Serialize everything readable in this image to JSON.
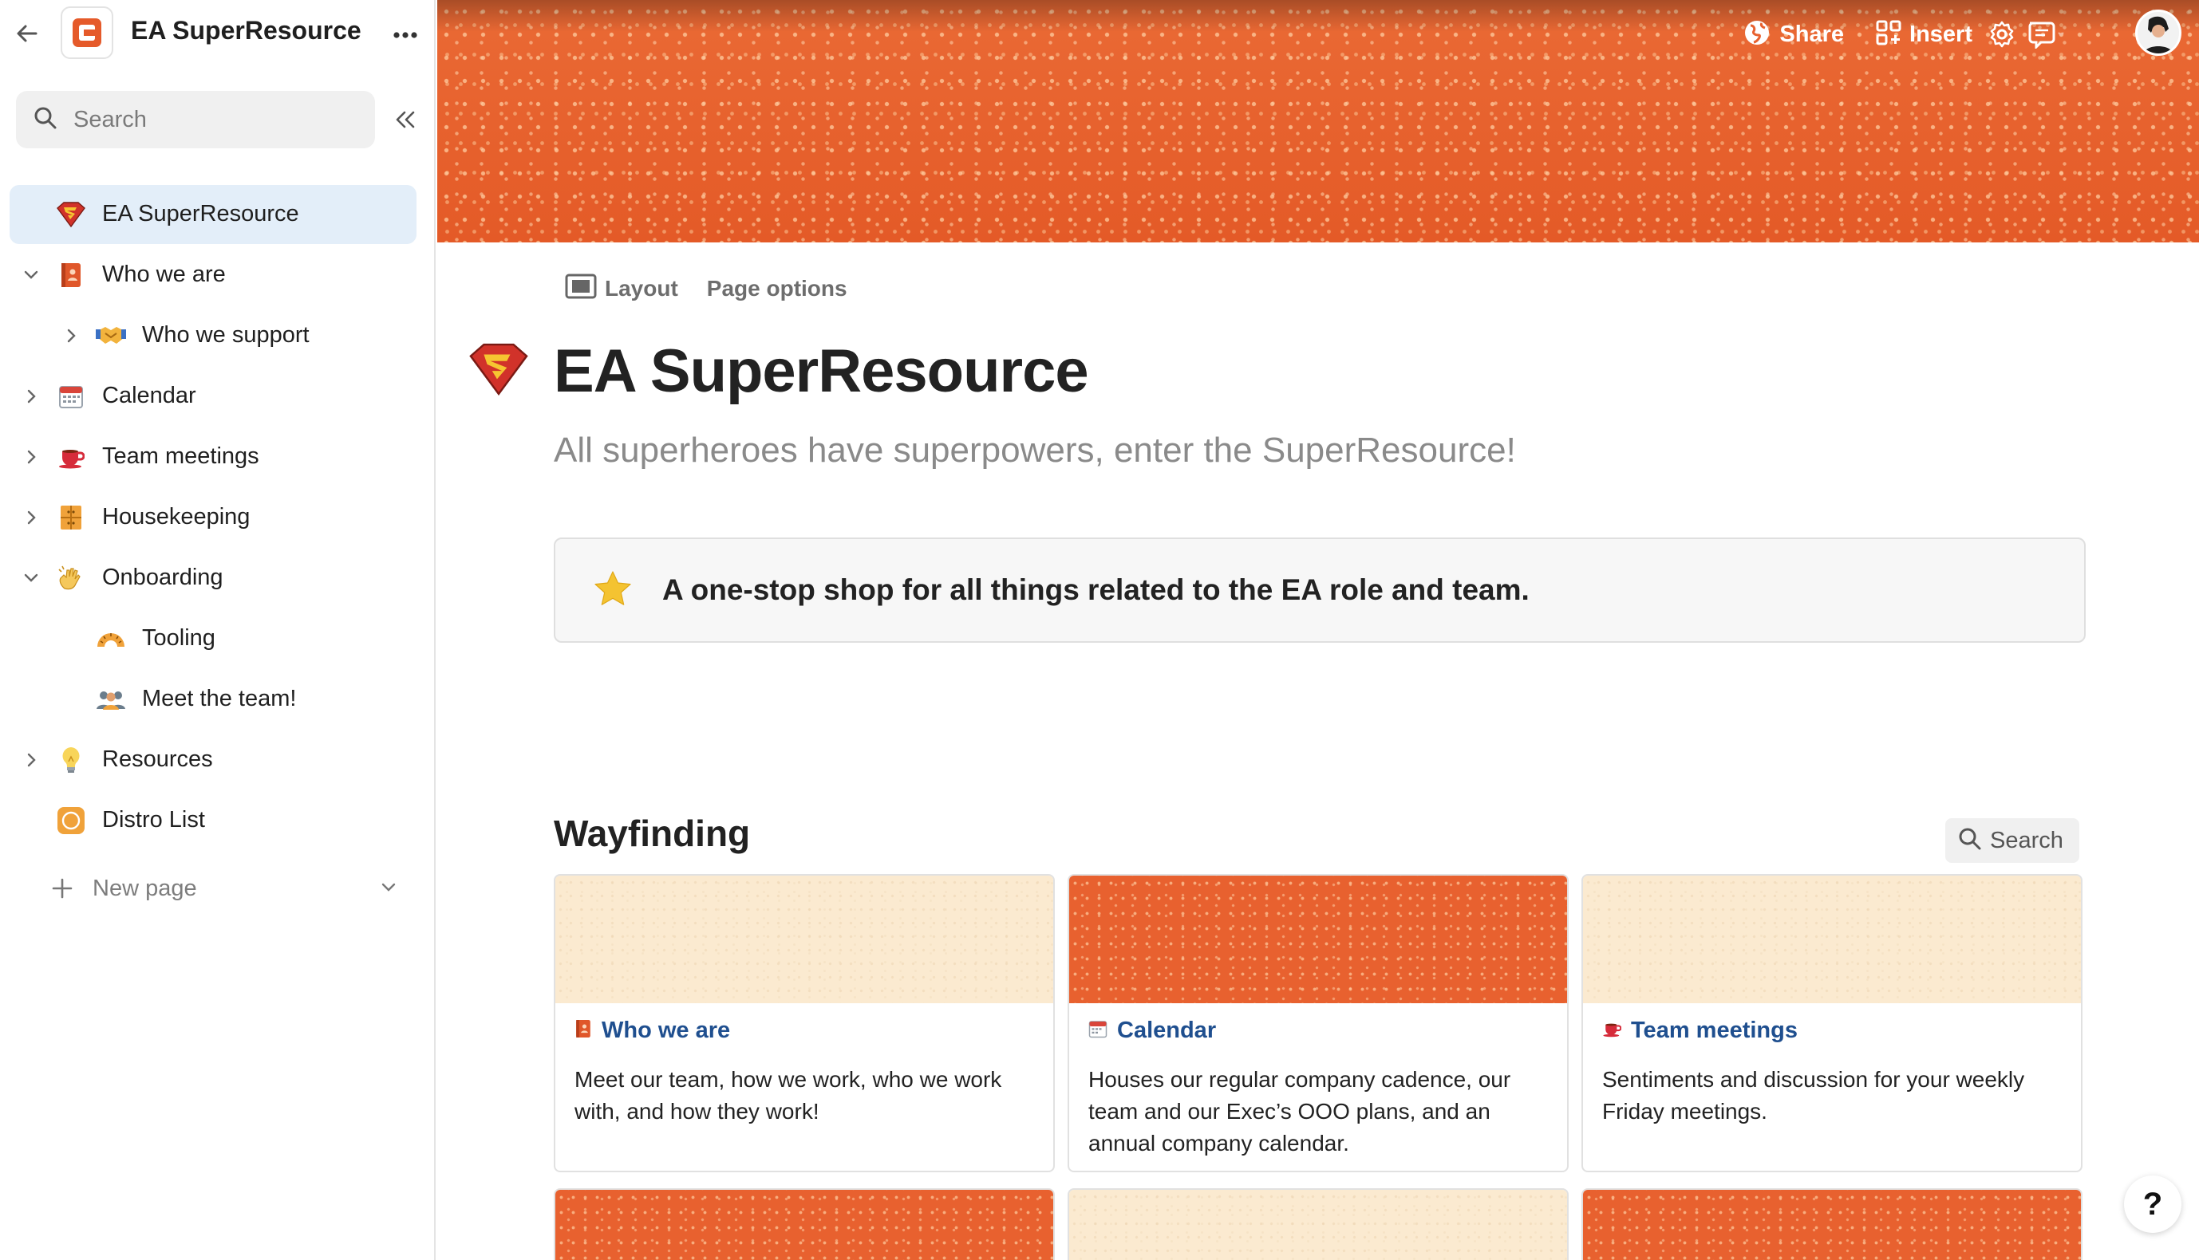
{
  "workspace": {
    "title": "EA SuperResource"
  },
  "sidebar": {
    "search_placeholder": "Search",
    "items": [
      {
        "label": "EA SuperResource",
        "icon": "superman-shield-icon",
        "level": 0,
        "active": true
      },
      {
        "label": "Who we are",
        "icon": "book-icon",
        "level": 0,
        "chevron": "down"
      },
      {
        "label": "Who we support",
        "icon": "handshake-icon",
        "level": 1,
        "chevron": "right"
      },
      {
        "label": "Calendar",
        "icon": "calendar-icon",
        "level": 0,
        "chevron": "right"
      },
      {
        "label": "Team meetings",
        "icon": "coffee-cup-icon",
        "level": 0,
        "chevron": "right"
      },
      {
        "label": "Housekeeping",
        "icon": "cabinet-icon",
        "level": 0,
        "chevron": "right"
      },
      {
        "label": "Onboarding",
        "icon": "waving-hand-icon",
        "level": 0,
        "chevron": "down"
      },
      {
        "label": "Tooling",
        "icon": "protractor-icon",
        "level": 1
      },
      {
        "label": "Meet the team!",
        "icon": "people-icon",
        "level": 1
      },
      {
        "label": "Resources",
        "icon": "lightbulb-icon",
        "level": 0,
        "chevron": "right"
      },
      {
        "label": "Distro List",
        "icon": "distro-orange-icon",
        "level": 0
      }
    ],
    "new_page_label": "New page"
  },
  "top_actions": {
    "share_label": "Share",
    "insert_label": "Insert"
  },
  "page": {
    "layout_label": "Layout",
    "page_options_label": "Page options",
    "title": "EA SuperResource",
    "subtitle": "All superheroes have superpowers, enter the SuperResource!",
    "callout_text": "A one-stop shop for all things related to the EA role and team."
  },
  "wayfinding": {
    "heading": "Wayfinding",
    "search_label": "Search",
    "cards": [
      {
        "title": "Who we are",
        "icon": "book-icon",
        "cover": "cream",
        "description": "Meet our team, how we work, who we work with, and how they work!"
      },
      {
        "title": "Calendar",
        "icon": "calendar-icon",
        "cover": "orange",
        "description": "Houses our regular company cadence, our team and our Exec’s OOO plans, and an annual company calendar."
      },
      {
        "title": "Team meetings",
        "icon": "coffee-cup-icon",
        "cover": "cream",
        "description": "Sentiments and discussion for your weekly Friday meetings."
      }
    ],
    "partial_cards_covers": [
      "orange",
      "cream",
      "orange"
    ]
  },
  "colors": {
    "accent_orange": "#e8612f",
    "cover_cream": "#fbead0",
    "active_nav": "#e3eef9",
    "link_blue": "#1f4f8f"
  },
  "help_label": "?"
}
